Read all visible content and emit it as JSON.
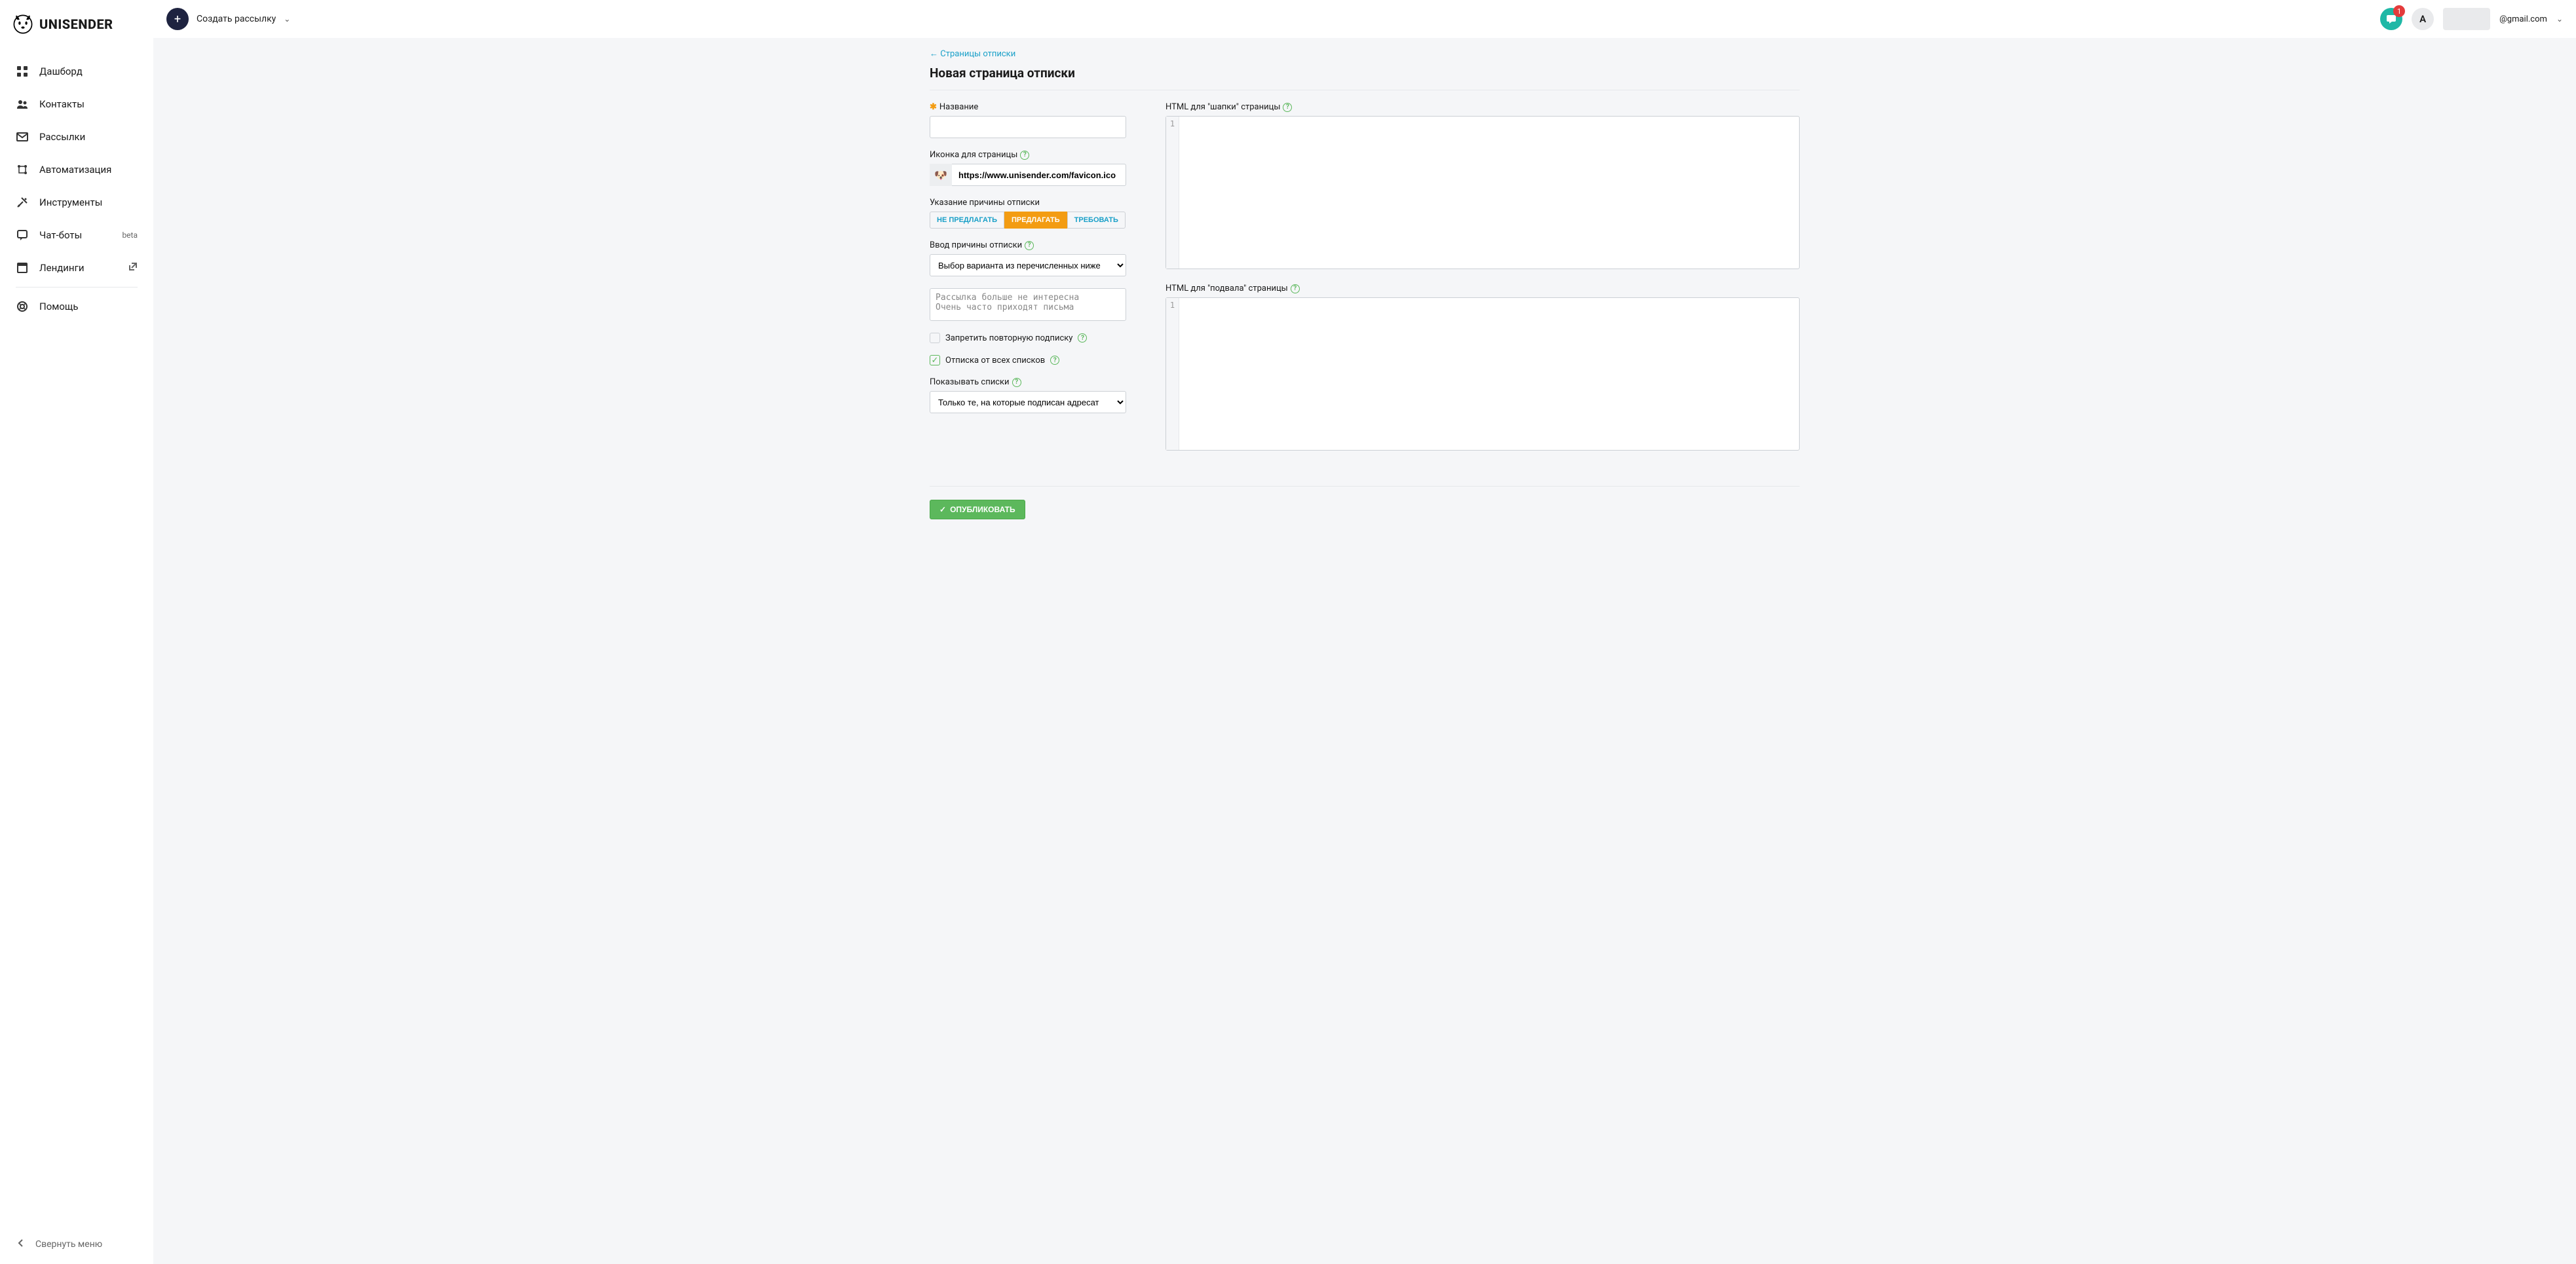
{
  "logo_text": "UNISENDER",
  "create_button": "Создать рассылку",
  "sidebar": {
    "items": [
      {
        "label": "Дашборд"
      },
      {
        "label": "Контакты"
      },
      {
        "label": "Рассылки"
      },
      {
        "label": "Автоматизация"
      },
      {
        "label": "Инструменты"
      },
      {
        "label": "Чат-боты",
        "badge": "beta"
      },
      {
        "label": "Лендинги",
        "external": true
      }
    ],
    "help": "Помощь",
    "collapse": "Свернуть меню"
  },
  "topbar": {
    "notification_count": "1",
    "avatar_initial": "A",
    "email_suffix": "@gmail.com"
  },
  "breadcrumb": {
    "arrow": "←",
    "label": "Страницы отписки"
  },
  "page_title": "Новая страница отписки",
  "form": {
    "name_label": "Название",
    "favicon_label": "Иконка для страницы",
    "favicon_url": "https://www.unisender.com/favicon.ico",
    "reason_mode_label": "Указание причины отписки",
    "reason_mode_options": [
      "НЕ ПРЕДЛАГАТЬ",
      "ПРЕДЛАГАТЬ",
      "ТРЕБОВАТЬ"
    ],
    "reason_input_label": "Ввод причины отписки",
    "reason_select_value": "Выбор варианта из перечисленных ниже",
    "reasons_text": "Рассылка больше не интересна\nОчень часто приходят письма",
    "deny_resubscribe": "Запретить повторную подписку",
    "unsubscribe_all": "Отписка от всех списков",
    "show_lists_label": "Показывать списки",
    "show_lists_value": "Только те, на которые подписан адресат",
    "header_html_label": "HTML для \"шапки\" страницы",
    "footer_html_label": "HTML для \"подвала\" страницы",
    "gutter_line": "1",
    "publish": "ОПУБЛИКОВАТЬ"
  }
}
